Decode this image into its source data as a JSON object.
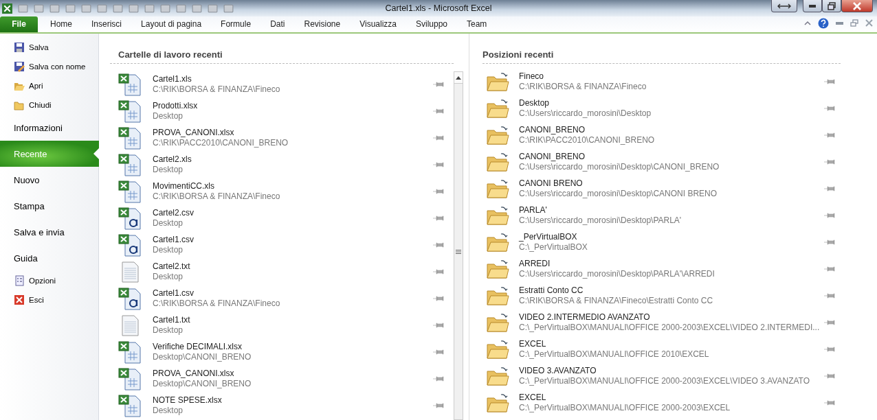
{
  "window": {
    "title": "Cartel1.xls  -  Microsoft Excel"
  },
  "ribbon_tabs": [
    {
      "label": "File",
      "kind": "file",
      "selected": true
    },
    {
      "label": "Home",
      "kind": "tab",
      "selected": false
    },
    {
      "label": "Inserisci",
      "kind": "tab",
      "selected": false
    },
    {
      "label": "Layout di pagina",
      "kind": "tab",
      "selected": false
    },
    {
      "label": "Formule",
      "kind": "tab",
      "selected": false
    },
    {
      "label": "Dati",
      "kind": "tab",
      "selected": false
    },
    {
      "label": "Revisione",
      "kind": "tab",
      "selected": false
    },
    {
      "label": "Visualizza",
      "kind": "tab",
      "selected": false
    },
    {
      "label": "Sviluppo",
      "kind": "tab",
      "selected": false
    },
    {
      "label": "Team",
      "kind": "tab",
      "selected": false
    }
  ],
  "sidebar": {
    "items": [
      {
        "label": "Salva",
        "kind": "command",
        "selected": false
      },
      {
        "label": "Salva con nome",
        "kind": "command",
        "selected": false
      },
      {
        "label": "Apri",
        "kind": "command",
        "selected": false
      },
      {
        "label": "Chiudi",
        "kind": "command",
        "selected": false
      },
      {
        "label": "Informazioni",
        "kind": "page",
        "selected": false
      },
      {
        "label": "Recente",
        "kind": "page",
        "selected": true
      },
      {
        "label": "Nuovo",
        "kind": "page",
        "selected": false
      },
      {
        "label": "Stampa",
        "kind": "page",
        "selected": false
      },
      {
        "label": "Salva e invia",
        "kind": "page",
        "selected": false
      },
      {
        "label": "Guida",
        "kind": "page",
        "selected": false
      },
      {
        "label": "Opzioni",
        "kind": "command",
        "selected": false
      },
      {
        "label": "Esci",
        "kind": "command",
        "selected": false
      }
    ]
  },
  "recent_workbooks": {
    "title": "Cartelle di lavoro recenti",
    "items": [
      {
        "name": "Cartel1.xls",
        "path": "C:\\RIK\\BORSA & FINANZA\\Fineco",
        "kind": "xls"
      },
      {
        "name": "Prodotti.xlsx",
        "path": "Desktop",
        "kind": "xls"
      },
      {
        "name": "PROVA_CANONI.xlsx",
        "path": "C:\\RIK\\PACC2010\\CANONI_BRENO",
        "kind": "xls"
      },
      {
        "name": "Cartel2.xls",
        "path": "Desktop",
        "kind": "xls"
      },
      {
        "name": "MovimentiCC.xls",
        "path": "C:\\RIK\\BORSA & FINANZA\\Fineco",
        "kind": "xls"
      },
      {
        "name": "Cartel2.csv",
        "path": "Desktop",
        "kind": "csv"
      },
      {
        "name": "Cartel1.csv",
        "path": "Desktop",
        "kind": "csv"
      },
      {
        "name": "Cartel2.txt",
        "path": "Desktop",
        "kind": "txt"
      },
      {
        "name": "Cartel1.csv",
        "path": "C:\\RIK\\BORSA & FINANZA\\Fineco",
        "kind": "csv"
      },
      {
        "name": "Cartel1.txt",
        "path": "Desktop",
        "kind": "txt"
      },
      {
        "name": "Verifiche DECIMALI.xlsx",
        "path": "Desktop\\CANONI_BRENO",
        "kind": "xls"
      },
      {
        "name": "PROVA_CANONI.xlsx",
        "path": "Desktop\\CANONI_BRENO",
        "kind": "xls"
      },
      {
        "name": "NOTE SPESE.xlsx",
        "path": "Desktop",
        "kind": "xls"
      }
    ]
  },
  "recent_places": {
    "title": "Posizioni recenti",
    "items": [
      {
        "name": "Fineco",
        "path": "C:\\RIK\\BORSA & FINANZA\\Fineco"
      },
      {
        "name": "Desktop",
        "path": "C:\\Users\\riccardo_morosini\\Desktop"
      },
      {
        "name": "CANONI_BRENO",
        "path": "C:\\RIK\\PACC2010\\CANONI_BRENO"
      },
      {
        "name": "CANONI_BRENO",
        "path": "C:\\Users\\riccardo_morosini\\Desktop\\CANONI_BRENO"
      },
      {
        "name": "CANONI BRENO",
        "path": "C:\\Users\\riccardo_morosini\\Desktop\\CANONI BRENO"
      },
      {
        "name": "PARLA'",
        "path": "C:\\Users\\riccardo_morosini\\Desktop\\PARLA'"
      },
      {
        "name": "_PerVirtualBOX",
        "path": "C:\\_PerVirtualBOX"
      },
      {
        "name": "ARREDI",
        "path": "C:\\Users\\riccardo_morosini\\Desktop\\PARLA'\\ARREDI"
      },
      {
        "name": "Estratti Conto CC",
        "path": "C:\\RIK\\BORSA & FINANZA\\Fineco\\Estratti Conto CC"
      },
      {
        "name": "VIDEO 2.INTERMEDIO AVANZATO",
        "path": "C:\\_PerVirtualBOX\\MANUALI\\OFFICE 2000-2003\\EXCEL\\VIDEO 2.INTERMEDI..."
      },
      {
        "name": "EXCEL",
        "path": "C:\\_PerVirtualBOX\\MANUALI\\OFFICE 2010\\EXCEL"
      },
      {
        "name": "VIDEO 3.AVANZATO",
        "path": "C:\\_PerVirtualBOX\\MANUALI\\OFFICE 2000-2003\\EXCEL\\VIDEO 3.AVANZATO"
      },
      {
        "name": "EXCEL",
        "path": "C:\\_PerVirtualBOX\\MANUALI\\OFFICE 2000-2003\\EXCEL"
      }
    ]
  }
}
